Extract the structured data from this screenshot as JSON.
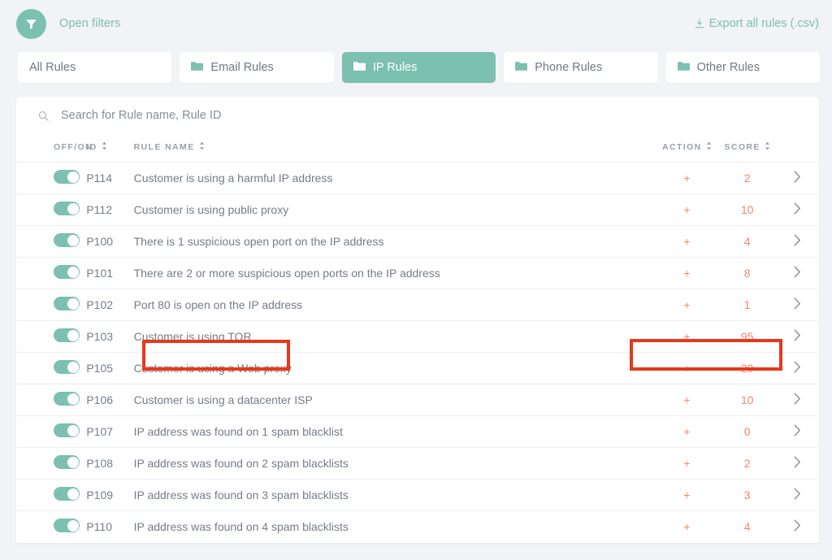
{
  "header": {
    "filter_icon": "filter-funnel-icon",
    "open_filters_label": "Open filters",
    "export_icon": "download-icon",
    "export_label": "Export all rules (.csv)"
  },
  "tabs": [
    {
      "label": "All Rules",
      "icon": null,
      "active": false
    },
    {
      "label": "Email Rules",
      "icon": "folder-icon",
      "active": false
    },
    {
      "label": "IP Rules",
      "icon": "folder-icon",
      "active": true
    },
    {
      "label": "Phone Rules",
      "icon": "folder-icon",
      "active": false
    },
    {
      "label": "Other Rules",
      "icon": "folder-icon",
      "active": false
    }
  ],
  "search": {
    "icon": "search-icon",
    "placeholder": "Search for Rule name, Rule ID",
    "value": ""
  },
  "table": {
    "columns": [
      {
        "key": "toggle",
        "label": "OFF/ON",
        "sortable": false
      },
      {
        "key": "id",
        "label": "ID",
        "sortable": true
      },
      {
        "key": "name",
        "label": "RULE NAME",
        "sortable": true
      },
      {
        "key": "action",
        "label": "ACTION",
        "sortable": true
      },
      {
        "key": "score",
        "label": "SCORE",
        "sortable": true
      }
    ],
    "rows": [
      {
        "enabled": true,
        "id": "P114",
        "name": "Customer is using a harmful IP address",
        "action": "+",
        "score": "2"
      },
      {
        "enabled": true,
        "id": "P112",
        "name": "Customer is using public proxy",
        "action": "+",
        "score": "10"
      },
      {
        "enabled": true,
        "id": "P100",
        "name": "There is 1 suspicious open port on the IP address",
        "action": "+",
        "score": "4"
      },
      {
        "enabled": true,
        "id": "P101",
        "name": "There are 2 or more suspicious open ports on the IP address",
        "action": "+",
        "score": "8"
      },
      {
        "enabled": true,
        "id": "P102",
        "name": "Port 80 is open on the IP address",
        "action": "+",
        "score": "1"
      },
      {
        "enabled": true,
        "id": "P103",
        "name": "Customer is using TOR",
        "action": "+",
        "score": "95"
      },
      {
        "enabled": true,
        "id": "P105",
        "name": "Customer is using a Web proxy",
        "action": "+",
        "score": "20"
      },
      {
        "enabled": true,
        "id": "P106",
        "name": "Customer is using a datacenter ISP",
        "action": "+",
        "score": "10"
      },
      {
        "enabled": true,
        "id": "P107",
        "name": "IP address was found on 1 spam blacklist",
        "action": "+",
        "score": "0"
      },
      {
        "enabled": true,
        "id": "P108",
        "name": "IP address was found on 2 spam blacklists",
        "action": "+",
        "score": "2"
      },
      {
        "enabled": true,
        "id": "P109",
        "name": "IP address was found on 3 spam blacklists",
        "action": "+",
        "score": "3"
      },
      {
        "enabled": true,
        "id": "P110",
        "name": "IP address was found on 4 spam blacklists",
        "action": "+",
        "score": "4"
      }
    ]
  },
  "annotations": [
    {
      "name": "highlight-rule-name-p103",
      "color": "#e8381b"
    },
    {
      "name": "highlight-score-p103",
      "color": "#e8381b"
    }
  ],
  "colors": {
    "accent_teal": "#7cc0b0",
    "score_red": "#ef8577",
    "page_bg": "#f1f3f6",
    "highlight": "#e8381b"
  }
}
